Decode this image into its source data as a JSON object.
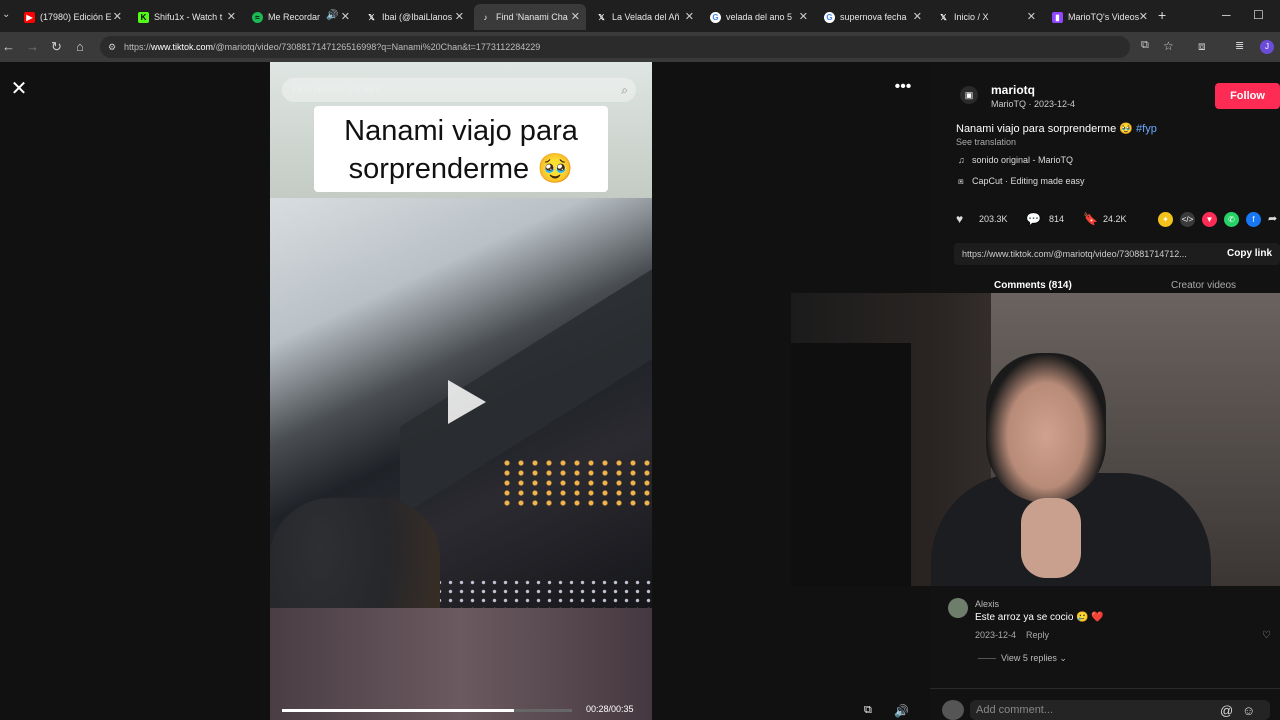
{
  "browser": {
    "tabs": [
      {
        "label": "(17980) Edición E",
        "icon": "youtube-icon",
        "color": "#ff0000"
      },
      {
        "label": "Shifu1x - Watch t",
        "icon": "kick-icon",
        "color": "#53fc18"
      },
      {
        "label": "Me Recordar",
        "icon": "spotify-icon",
        "color": "#1db954"
      },
      {
        "label": "Ibai (@IbaiLlanos",
        "icon": "x-icon",
        "color": "#ffffff"
      },
      {
        "label": "Find 'Nanami Cha",
        "icon": "tiktok-icon",
        "color": "#ffffff"
      },
      {
        "label": "La Velada del Añ",
        "icon": "x-icon",
        "color": "#ffffff"
      },
      {
        "label": "velada del ano 5",
        "icon": "google-icon",
        "color": "#4285f4"
      },
      {
        "label": "supernova fecha",
        "icon": "google-icon",
        "color": "#4285f4"
      },
      {
        "label": "Inicio / X",
        "icon": "x-icon",
        "color": "#ffffff"
      },
      {
        "label": "MarioTQ's Videos",
        "icon": "twitch-icon",
        "color": "#9146ff"
      }
    ],
    "url_prefix": "https://",
    "url_domain": "www.tiktok.com",
    "url_rest": "/@mariotq/video/7308817147126516998?q=Nanami%20Chan&t=1773112284229"
  },
  "video": {
    "search_placeholder": "Find related content",
    "caption_line1": "Nanami viajo para",
    "caption_line2": "sorprenderme 🥹",
    "timecode": "00:28/00:35",
    "progress": 0.8
  },
  "post": {
    "username": "mariotq",
    "subline": "MarioTQ · 2023-12-4",
    "follow_label": "Follow",
    "description": "Nanami viajo para sorprenderme 🥹",
    "hashtag": "#fyp",
    "see_translation": "See translation",
    "sound": "sonido original - MarioTQ",
    "capcut": "CapCut · Editing made easy",
    "likes": "203.3K",
    "comments_count": "814",
    "saves": "24.2K",
    "link": "https://www.tiktok.com/@mariotq/video/730881714712...",
    "copy_link": "Copy link",
    "tab_comments": "Comments (814)",
    "tab_creator": "Creator videos"
  },
  "comment": {
    "author": "Alexis",
    "text": "Este arroz ya se cocio 🥲 ❤️",
    "date": "2023-12-4",
    "reply": "Reply",
    "view_replies": "View 5 replies ⌄"
  },
  "add_comment": {
    "placeholder": "Add comment..."
  }
}
